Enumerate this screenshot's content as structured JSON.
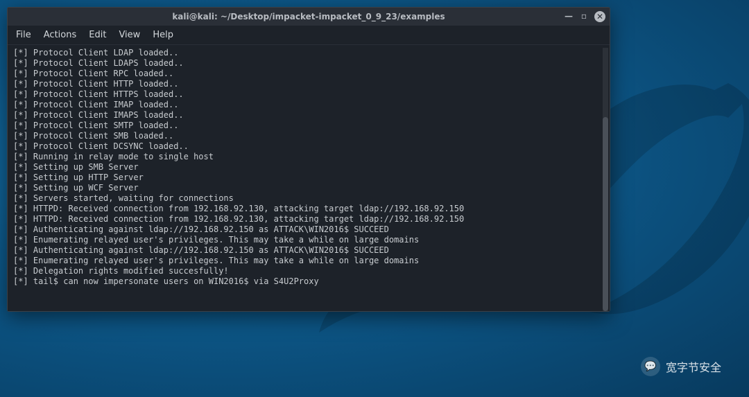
{
  "titlebar": {
    "title": "kali@kali: ~/Desktop/impacket-impacket_0_9_23/examples",
    "minimize": "—",
    "maximize": "▫",
    "close": "✕"
  },
  "menubar": {
    "file": "File",
    "actions": "Actions",
    "edit": "Edit",
    "view": "View",
    "help": "Help"
  },
  "terminal": {
    "lines": [
      "[*] Protocol Client LDAP loaded..",
      "[*] Protocol Client LDAPS loaded..",
      "[*] Protocol Client RPC loaded..",
      "[*] Protocol Client HTTP loaded..",
      "[*] Protocol Client HTTPS loaded..",
      "[*] Protocol Client IMAP loaded..",
      "[*] Protocol Client IMAPS loaded..",
      "[*] Protocol Client SMTP loaded..",
      "[*] Protocol Client SMB loaded..",
      "[*] Protocol Client DCSYNC loaded..",
      "[*] Running in relay mode to single host",
      "[*] Setting up SMB Server",
      "[*] Setting up HTTP Server",
      "[*] Setting up WCF Server",
      "",
      "[*] Servers started, waiting for connections",
      "[*] HTTPD: Received connection from 192.168.92.130, attacking target ldap://192.168.92.150",
      "[*] HTTPD: Received connection from 192.168.92.130, attacking target ldap://192.168.92.150",
      "[*] Authenticating against ldap://192.168.92.150 as ATTACK\\WIN2016$ SUCCEED",
      "[*] Enumerating relayed user's privileges. This may take a while on large domains",
      "[*] Authenticating against ldap://192.168.92.150 as ATTACK\\WIN2016$ SUCCEED",
      "[*] Enumerating relayed user's privileges. This may take a while on large domains",
      "[*] Delegation rights modified succesfully!",
      "[*] tail$ can now impersonate users on WIN2016$ via S4U2Proxy"
    ]
  },
  "watermark": {
    "text": "宽字节安全"
  }
}
